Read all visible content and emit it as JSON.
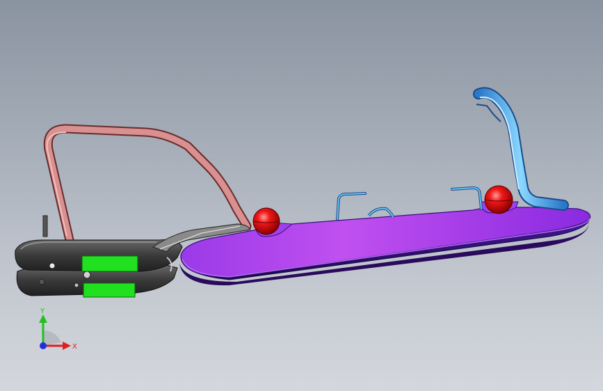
{
  "viewport": {
    "background_top": "#8a93a0",
    "background_bottom": "#d4d7dd"
  },
  "model": {
    "plate_color": "#7a1fd6",
    "plate_underside_color": "#2a0a5c",
    "ball_color": "#e01010",
    "handle_color": "#c87878",
    "cable_color": "#5ab0e8",
    "tab_color": "#22e022",
    "clamp_color": "#3a3a3a"
  },
  "triad": {
    "x_label": "X",
    "y_label": "Y",
    "x_color": "#e02020",
    "y_color": "#20c020",
    "z_color": "#2030e0"
  }
}
